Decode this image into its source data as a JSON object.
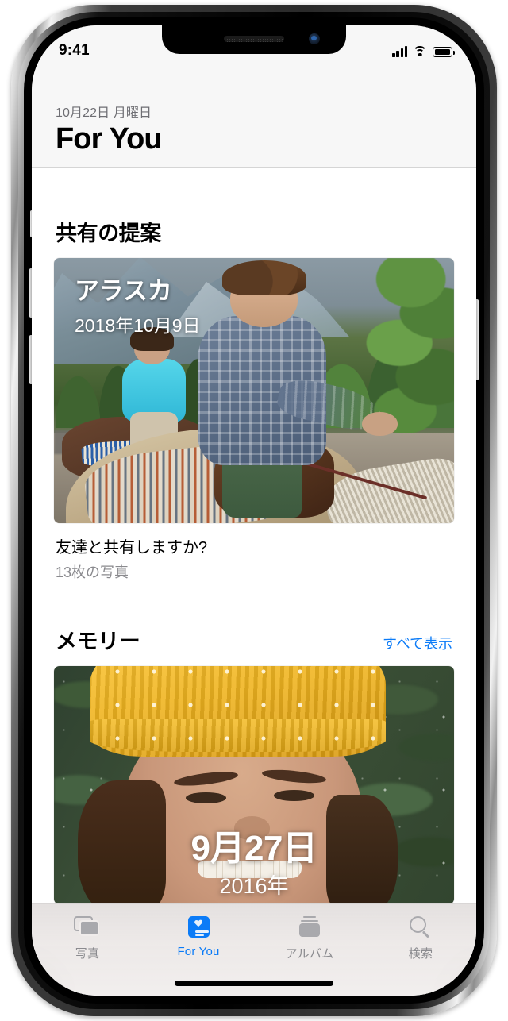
{
  "device": {
    "name": "iPhone X"
  },
  "status_bar": {
    "time": "9:41",
    "icons": [
      "cellular-signal-icon",
      "wifi-icon",
      "battery-icon"
    ]
  },
  "nav_header": {
    "date": "10月22日 月曜日",
    "title": "For You"
  },
  "sections": {
    "sharing_suggestions": {
      "title": "共有の提案",
      "card": {
        "overlay_title": "アラスカ",
        "overlay_date": "2018年10月9日",
        "caption": "友達と共有しますか?",
        "photo_count": "13枚の写真"
      }
    },
    "memories": {
      "title": "メモリー",
      "see_all": "すべて表示",
      "card": {
        "date": "9月27日",
        "year": "2016年"
      }
    }
  },
  "tab_bar": {
    "tabs": [
      {
        "label": "写真",
        "icon": "photos-icon",
        "active": false
      },
      {
        "label": "For You",
        "icon": "foryou-icon",
        "active": true
      },
      {
        "label": "アルバム",
        "icon": "albums-icon",
        "active": false
      },
      {
        "label": "検索",
        "icon": "search-icon",
        "active": false
      }
    ]
  },
  "colors": {
    "accent": "#0b7bf7",
    "inactive_tab": "#8b8b8f",
    "secondary_text": "#8a8a8e",
    "header_background": "#f7f7f7"
  }
}
